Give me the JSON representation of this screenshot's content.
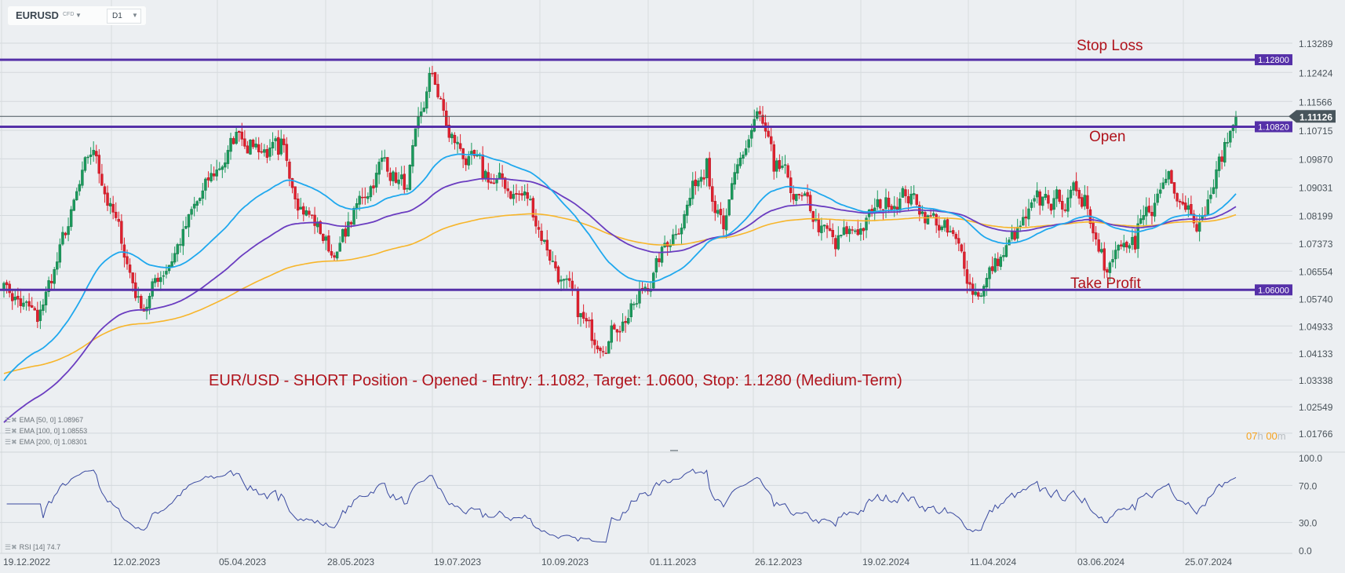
{
  "toolbar": {
    "symbol": "EURUSD",
    "type": "CFD",
    "timeframe": "D1"
  },
  "annotations": {
    "stop_loss": "Stop Loss",
    "open": "Open",
    "take_profit": "Take Profit",
    "caption": "EUR/USD - SHORT Position - Opened - Entry: 1.1082, Target: 1.0600, Stop: 1.1280 (Medium-Term)"
  },
  "indicators": {
    "ema50": "EMA  [50,  0]  1.08967",
    "ema100": "EMA  [100,  0]  1.08553",
    "ema200": "EMA  [200,  0]  1.08301",
    "rsi": "RSI  [14]  74.7"
  },
  "timer": {
    "hours": "07",
    "h": "h",
    "minutes": "00",
    "m": "m"
  },
  "colors": {
    "up": "#1a9a5c",
    "down": "#e0202e",
    "level": "#5530a8",
    "ema50": "#1fa8ee",
    "ema100": "#6a3cc0",
    "ema200": "#f7b52a",
    "rsi": "#3a4aa0",
    "annotation": "#b0131c"
  },
  "chart_data": {
    "type": "candlestick",
    "symbol": "EURUSD",
    "timeframe": "D1",
    "y_ticks": [
      "1.13289",
      "1.12424",
      "1.11566",
      "1.10715",
      "1.09870",
      "1.09031",
      "1.08199",
      "1.07373",
      "1.06554",
      "1.05740",
      "1.04933",
      "1.04133",
      "1.03338",
      "1.02549",
      "1.01766"
    ],
    "ylim": [
      1.01766,
      1.13289
    ],
    "x_ticks": [
      "19.12.2022",
      "12.02.2023",
      "05.04.2023",
      "28.05.2023",
      "19.07.2023",
      "10.09.2023",
      "01.11.2023",
      "26.12.2023",
      "19.02.2024",
      "11.04.2024",
      "03.06.2024",
      "25.07.2024"
    ],
    "n_bars": 441,
    "close_keypoints": [
      [
        0,
        1.062
      ],
      [
        12,
        1.0506
      ],
      [
        32,
        1.1013
      ],
      [
        49,
        1.0545
      ],
      [
        84,
        1.1065
      ],
      [
        98,
        1.1
      ],
      [
        118,
        1.0696
      ],
      [
        135,
        1.099
      ],
      [
        144,
        1.09
      ],
      [
        153,
        1.124
      ],
      [
        159,
        1.105
      ],
      [
        171,
        1.093
      ],
      [
        187,
        1.087
      ],
      [
        205,
        1.052
      ],
      [
        210,
        1.045
      ],
      [
        226,
        1.056
      ],
      [
        232,
        1.065
      ],
      [
        251,
        1.0988
      ],
      [
        257,
        1.078
      ],
      [
        269,
        1.1127
      ],
      [
        275,
        1.095
      ],
      [
        297,
        1.0721
      ],
      [
        321,
        1.09
      ],
      [
        337,
        1.077
      ],
      [
        347,
        1.0594
      ],
      [
        370,
        1.085
      ],
      [
        386,
        1.088
      ],
      [
        392,
        1.072
      ],
      [
        404,
        1.072
      ],
      [
        416,
        1.095
      ],
      [
        428,
        1.082
      ],
      [
        440,
        1.111
      ]
    ],
    "ema_seed": {
      "ema50": 1.032,
      "ema100": 1.02,
      "ema200": 1.035
    },
    "levels": [
      {
        "name": "stop-loss",
        "price": 1.128,
        "label": "1.12800"
      },
      {
        "name": "open",
        "price": 1.1082,
        "label": "1.10820"
      },
      {
        "name": "take-profit",
        "price": 1.06,
        "label": "1.06000"
      }
    ],
    "current_price": {
      "price": 1.11126,
      "label": "1.11126"
    },
    "rsi": {
      "period": 14,
      "last": 74.7,
      "ticks": [
        "100.0",
        "70.0",
        "30.0",
        "0.0"
      ],
      "ylim": [
        0,
        100
      ]
    }
  }
}
